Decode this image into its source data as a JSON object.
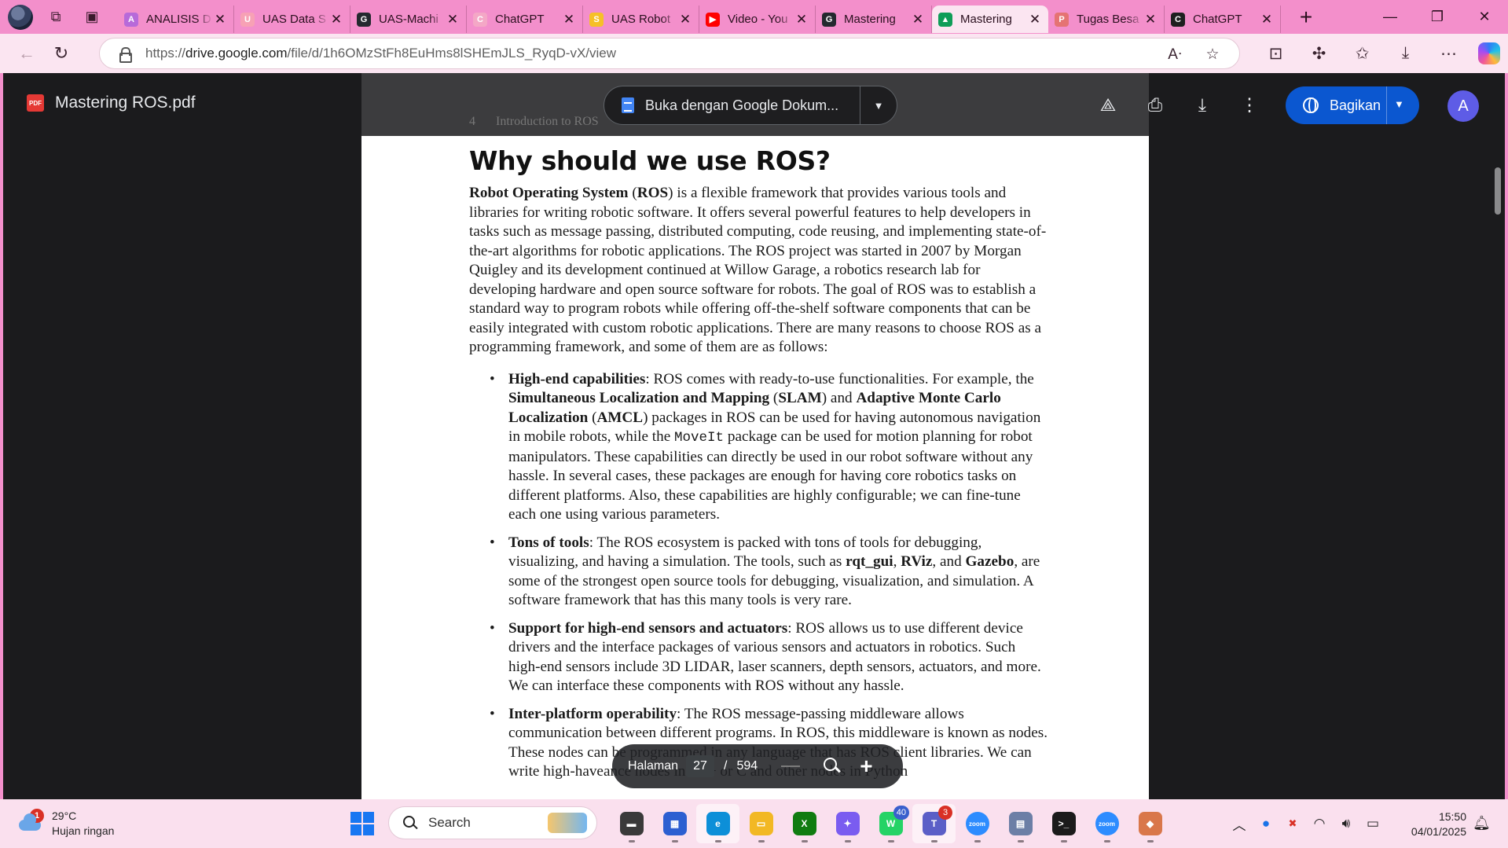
{
  "browser": {
    "tabs": [
      {
        "title": "ANALISIS D",
        "favicon_color": "#b76ad9",
        "favicon_glyph": "A"
      },
      {
        "title": "UAS Data S",
        "favicon_color": "#f7a1b5",
        "favicon_glyph": "U"
      },
      {
        "title": "UAS-Machi",
        "favicon_color": "#24292f",
        "favicon_glyph": "G"
      },
      {
        "title": "ChatGPT",
        "favicon_color": "#f4a7c6",
        "favicon_glyph": "C"
      },
      {
        "title": "UAS Robot",
        "favicon_color": "#f6c028",
        "favicon_glyph": "S"
      },
      {
        "title": "Video - You",
        "favicon_color": "#ff0000",
        "favicon_glyph": "▶"
      },
      {
        "title": "Mastering",
        "favicon_color": "#24292f",
        "favicon_glyph": "G"
      },
      {
        "title": "Mastering",
        "favicon_color": "#0f9d58",
        "favicon_glyph": "▲",
        "active": true
      },
      {
        "title": "Tugas Besa",
        "favicon_color": "#e57373",
        "favicon_glyph": "P"
      },
      {
        "title": "ChatGPT",
        "favicon_color": "#1f1f1f",
        "favicon_glyph": "C"
      }
    ],
    "url_prefix": "https://",
    "url_domain": "drive.google.com",
    "url_path": "/file/d/1h6OMzStFh8EuHms8lSHEmJLS_RyqD-vX/view"
  },
  "viewer": {
    "file_name": "Mastering ROS.pdf",
    "pdf_badge": "PDF",
    "open_with_label": "Buka dengan Google Dokum...",
    "share_label": "Bagikan",
    "account_initial": "A"
  },
  "pdf": {
    "running_head_page": "4",
    "running_head_title": "Introduction to ROS",
    "heading": "Why should we use ROS?",
    "intro": {
      "bold1": "Robot Operating System",
      "t1": " (",
      "bold2": "ROS",
      "t2": ") is a flexible framework that provides various tools and libraries for writing robotic software. It offers several powerful features to help developers in tasks such as message passing, distributed computing, code reusing, and implementing state-of-the-art algorithms for robotic applications. The ROS project was started in 2007 by Morgan Quigley and its development continued at Willow Garage, a robotics research lab for developing hardware and open source software for robots. The goal of ROS was to establish a standard way to program robots while offering off-the-shelf software components that can be easily integrated with custom robotic applications. There are many reasons to choose ROS as a programming framework, and some of them are as follows:"
    },
    "bullet1": {
      "title": "High-end capabilities",
      "t1": ": ROS comes with ready-to-use functionalities. For example, the ",
      "b1": "Simultaneous Localization and Mapping",
      "t2": " (",
      "b2": "SLAM",
      "t3": ") and ",
      "b3": "Adaptive Monte Carlo Localization",
      "t4": " (",
      "b4": "AMCL",
      "t5": ") packages in ROS can be used for having autonomous navigation in mobile robots, while the ",
      "code": "MoveIt",
      "t6": " package can be used for motion planning for robot manipulators. These capabilities can directly be used in our robot software without any hassle. In several cases, these packages are enough for having core robotics tasks on different platforms. Also, these capabilities are highly configurable; we can fine-tune each one using various parameters."
    },
    "bullet2": {
      "title": "Tons of tools",
      "t1": ": The ROS ecosystem is packed with tons of tools for debugging, visualizing, and having a simulation. The tools, such as ",
      "b1": "rqt_gui",
      "t2": ", ",
      "b2": "RViz",
      "t3": ", and ",
      "b3": "Gazebo",
      "t4": ", are some of the strongest open source tools for debugging, visualization, and simulation. A software framework that has this many tools is very rare."
    },
    "bullet3": {
      "title": "Support for high-end sensors and actuators",
      "t1": ": ROS allows us to use different device drivers and the interface packages of various sensors and actuators in robotics. Such high-end sensors include 3D LIDAR, laser scanners, depth sensors, actuators, and more. We can interface these components with ROS without any hassle."
    },
    "bullet4": {
      "title": "Inter-platform operability",
      "t1": ": The ROS message-passing middleware allows communication between different programs. In ROS, this middleware is known as nodes. These nodes can be programmed in any language that has ROS client libraries. We can write high-haveance nodes in C++ or C and other nodes in Python"
    }
  },
  "page_nav": {
    "label": "Halaman",
    "current": "27",
    "separator": "/",
    "total": "594"
  },
  "taskbar": {
    "weather_temp": "29°C",
    "weather_desc": "Hujan ringan",
    "weather_badge": "1",
    "search_placeholder": "Search",
    "apps": [
      {
        "name": "file-viewer",
        "color": "#3a3a3a",
        "glyph": "▬"
      },
      {
        "name": "store",
        "color": "#2c5fd1",
        "glyph": "▦"
      },
      {
        "name": "edge",
        "color": "#0d8fd8",
        "glyph": "e",
        "active": true
      },
      {
        "name": "file-explorer",
        "color": "#f2b824",
        "glyph": "▭"
      },
      {
        "name": "xbox",
        "color": "#107c10",
        "glyph": "X"
      },
      {
        "name": "copilot",
        "color": "#7a5cf0",
        "glyph": "✦"
      },
      {
        "name": "whatsapp",
        "color": "#25d366",
        "glyph": "W",
        "badge": "40"
      },
      {
        "name": "teams",
        "color": "#5b5fc7",
        "glyph": "T",
        "badge": "3",
        "badge_red": true,
        "active": true
      },
      {
        "name": "zoom",
        "color": "#2d8cff",
        "glyph": "zoom"
      },
      {
        "name": "app-tool",
        "color": "#6c7fa6",
        "glyph": "▤"
      },
      {
        "name": "terminal",
        "color": "#1b1b1b",
        "glyph": ">_"
      },
      {
        "name": "zoom-2",
        "color": "#2d8cff",
        "glyph": "zoom"
      },
      {
        "name": "app-box",
        "color": "#d9774a",
        "glyph": "◆"
      }
    ],
    "time": "15:50",
    "date": "04/01/2025"
  }
}
